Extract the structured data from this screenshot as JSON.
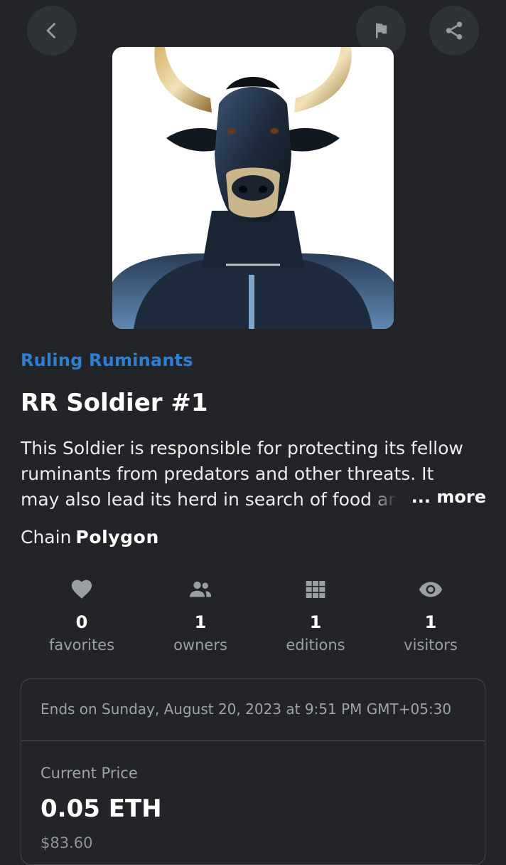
{
  "nav": {
    "back_icon": "chevron-left-icon",
    "flag_icon": "flag-icon",
    "share_icon": "share-icon"
  },
  "artwork": {
    "subject": "bull-soldier-nft-image"
  },
  "collection_name": "Ruling Ruminants",
  "item_title": "RR Soldier #1",
  "description": {
    "line1": "This Soldier is responsible for protecting its fellow",
    "line2": "ruminants from predators and other threats. It",
    "line3": "may also lead its herd in search of food and",
    "more_label": "... more"
  },
  "chain": {
    "label": "Chain",
    "value": "Polygon"
  },
  "stats": [
    {
      "icon": "heart-icon",
      "value": "0",
      "label": "favorites"
    },
    {
      "icon": "people-icon",
      "value": "1",
      "label": "owners"
    },
    {
      "icon": "grid-icon",
      "value": "1",
      "label": "editions"
    },
    {
      "icon": "eye-icon",
      "value": "1",
      "label": "visitors"
    }
  ],
  "auction": {
    "ends_text": "Ends on Sunday, August 20, 2023 at 9:51 PM GMT+05:30",
    "current_price_label": "Current Price",
    "price": "0.05 ETH",
    "usd_price": "$83.60"
  },
  "colors": {
    "background": "#222427",
    "accent": "#2d7fd3",
    "button_bg": "#2f3236",
    "muted_text": "#9b9ea3"
  }
}
